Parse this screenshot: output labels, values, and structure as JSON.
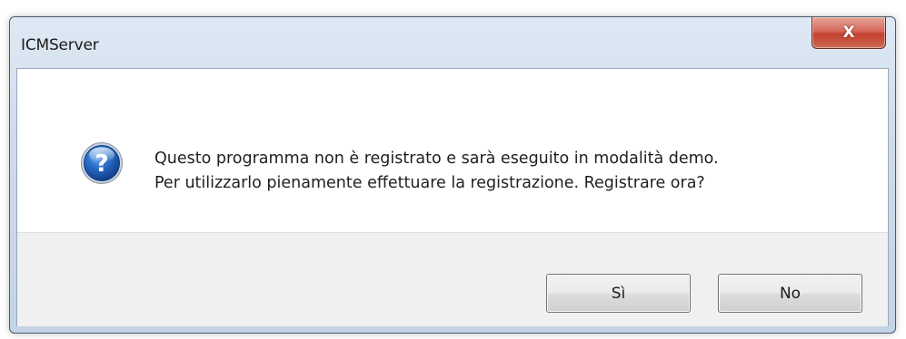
{
  "window": {
    "title": "ICMServer",
    "close_label": "X"
  },
  "message": {
    "icon": "question-icon",
    "line1": "Questo programma non è registrato e sarà eseguito in modalità demo.",
    "line2": "Per utilizzarlo pienamente effettuare la registrazione. Registrare ora?"
  },
  "buttons": {
    "yes_label": "Sì",
    "no_label": "No"
  },
  "colors": {
    "close_button": "#c2402f",
    "icon_blue": "#1f5fb8",
    "button_area": "#f0f0f0"
  }
}
